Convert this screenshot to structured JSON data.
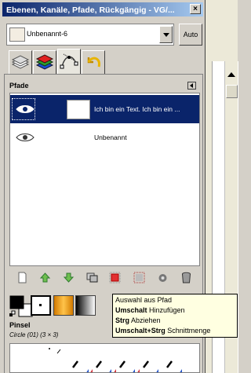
{
  "window": {
    "title": "Ebenen, Kanäle, Pfade, Rückgängig - VG/...",
    "close_label": "×"
  },
  "image_selector": {
    "selected": "Unbenannt-6",
    "auto_label": "Auto"
  },
  "tabs": [
    {
      "name": "layers",
      "icon": "layers-icon"
    },
    {
      "name": "channels",
      "icon": "channels-icon"
    },
    {
      "name": "paths",
      "icon": "paths-icon",
      "active": true
    },
    {
      "name": "undo",
      "icon": "undo-icon"
    }
  ],
  "paths_panel": {
    "label": "Pfade",
    "rows": [
      {
        "text": "Ich bin ein Text. Ich bin ein ...",
        "selected": true
      },
      {
        "text": "Unbenannt",
        "selected": false
      }
    ]
  },
  "toolbar": {
    "icons": [
      "new-path-icon",
      "raise-path-icon",
      "lower-path-icon",
      "duplicate-path-icon",
      "path-to-selection-icon",
      "selection-to-path-icon",
      "paint-along-path-icon",
      "delete-path-icon"
    ]
  },
  "brushes": {
    "label": "Pinsel",
    "selected": "Circle (01) (3 × 3)"
  },
  "tooltip": {
    "line1": "Auswahl aus Pfad",
    "line2_key": "Umschalt",
    "line2_action": "Hinzufügen",
    "line3_key": "Strg",
    "line3_action": "Abziehen",
    "line4_key": "Umschalt+Strg",
    "line4_action": "Schnittmenge"
  },
  "colors": {
    "selection": "#0a246a",
    "title_start": "#0a246a",
    "title_end": "#a6caf0",
    "tooltip_bg": "#ffffe1"
  }
}
